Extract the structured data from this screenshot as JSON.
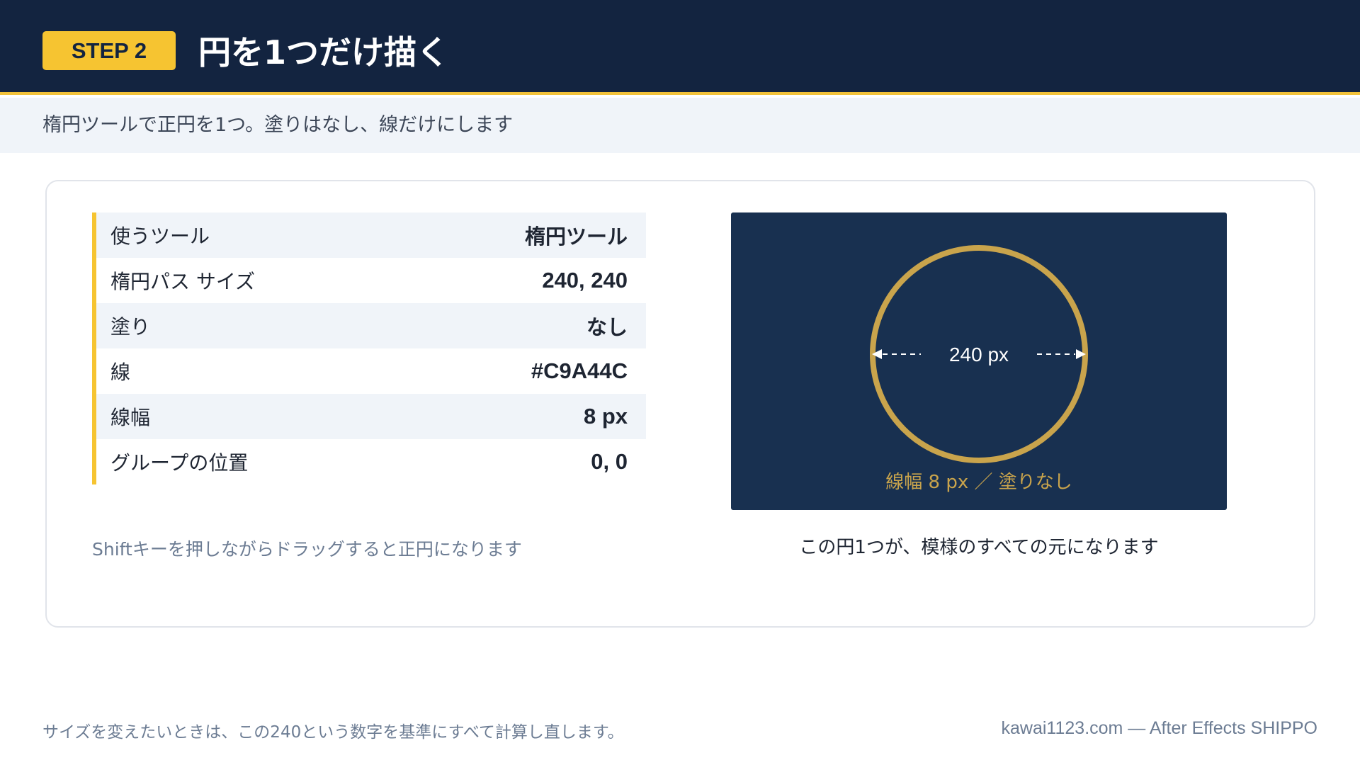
{
  "header": {
    "step_label": "STEP 2",
    "title": "円を1つだけ描く"
  },
  "subtitle": "楕円ツールで正円を1つ。塗りはなし、線だけにします",
  "specs": [
    {
      "label": "使うツール",
      "value": "楕円ツール"
    },
    {
      "label": "楕円パス サイズ",
      "value": "240, 240"
    },
    {
      "label": "塗り",
      "value": "なし"
    },
    {
      "label": "線",
      "value": "#C9A44C"
    },
    {
      "label": "線幅",
      "value": "8 px"
    },
    {
      "label": "グループの位置",
      "value": "0, 0"
    }
  ],
  "shift_note": "Shiftキーを押しながらドラッグすると正円になります",
  "preview": {
    "dimension_label": "240 px",
    "stroke_label": "線幅 8 px ／ 塗りなし",
    "circle_color": "#C9A44C",
    "background_color": "#183050"
  },
  "caption": "この円1つが、模様のすべての元になります",
  "footer": {
    "note": "サイズを変えたいときは、この240という数字を基準にすべて計算し直します。",
    "credit": "kawai1123.com — After Effects SHIPPO"
  },
  "colors": {
    "header_bg": "#132440",
    "accent": "#F6C431",
    "subbar_bg": "#F0F4F9"
  }
}
